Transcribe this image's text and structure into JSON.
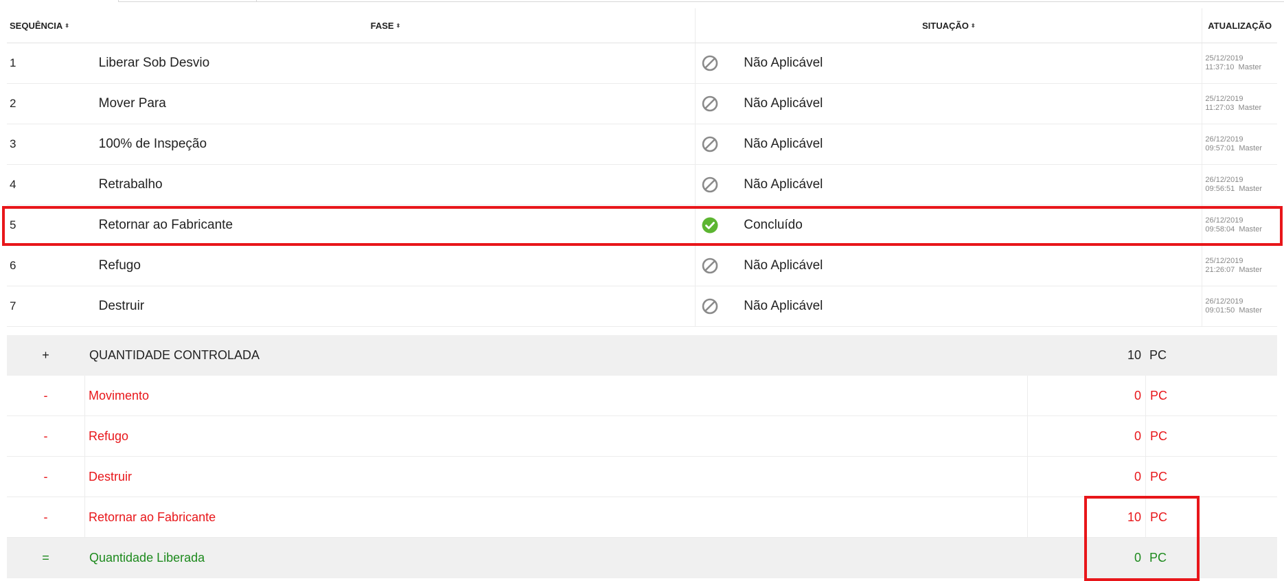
{
  "table": {
    "headers": {
      "sequencia": "SEQUÊNCIA",
      "fase": "FASE",
      "situacao": "SITUAÇÃO",
      "atualizacao": "ATUALIZAÇÃO",
      "sort_icon": "⬍"
    },
    "rows": [
      {
        "seq": "1",
        "fase": "Liberar Sob Desvio",
        "situacao": "Não Aplicável",
        "status_icon": "blocked-icon",
        "date": "25/12/2019",
        "time": "11:37:10",
        "user": "Master"
      },
      {
        "seq": "2",
        "fase": "Mover Para",
        "situacao": "Não Aplicável",
        "status_icon": "blocked-icon",
        "date": "25/12/2019",
        "time": "11:27:03",
        "user": "Master"
      },
      {
        "seq": "3",
        "fase": "100% de Inspeção",
        "situacao": "Não Aplicável",
        "status_icon": "blocked-icon",
        "date": "26/12/2019",
        "time": "09:57:01",
        "user": "Master"
      },
      {
        "seq": "4",
        "fase": "Retrabalho",
        "situacao": "Não Aplicável",
        "status_icon": "blocked-icon",
        "date": "26/12/2019",
        "time": "09:56:51",
        "user": "Master"
      },
      {
        "seq": "5",
        "fase": "Retornar ao Fabricante",
        "situacao": "Concluído",
        "status_icon": "check-circle-icon",
        "date": "26/12/2019",
        "time": "09:58:04",
        "user": "Master"
      },
      {
        "seq": "6",
        "fase": "Refugo",
        "situacao": "Não Aplicável",
        "status_icon": "blocked-icon",
        "date": "25/12/2019",
        "time": "21:26:07",
        "user": "Master"
      },
      {
        "seq": "7",
        "fase": "Destruir",
        "situacao": "Não Aplicável",
        "status_icon": "blocked-icon",
        "date": "26/12/2019",
        "time": "09:01:50",
        "user": "Master"
      }
    ]
  },
  "quantities": [
    {
      "op": "+",
      "label": "QUANTIDADE CONTROLADA",
      "value": "10",
      "unit": "PC",
      "style": "black"
    },
    {
      "op": "-",
      "label": "Movimento",
      "value": "0",
      "unit": "PC",
      "style": "red"
    },
    {
      "op": "-",
      "label": "Refugo",
      "value": "0",
      "unit": "PC",
      "style": "red"
    },
    {
      "op": "-",
      "label": "Destruir",
      "value": "0",
      "unit": "PC",
      "style": "red"
    },
    {
      "op": "-",
      "label": "Retornar ao Fabricante",
      "value": "10",
      "unit": "PC",
      "style": "red"
    },
    {
      "op": "=",
      "label": "Quantidade Liberada",
      "value": "0",
      "unit": "PC",
      "style": "green"
    }
  ],
  "colors": {
    "highlight": "#e8161a",
    "negative": "#e8161a",
    "released": "#1d8a1d",
    "ok": "#5cb531",
    "na": "#8a8a8a"
  }
}
